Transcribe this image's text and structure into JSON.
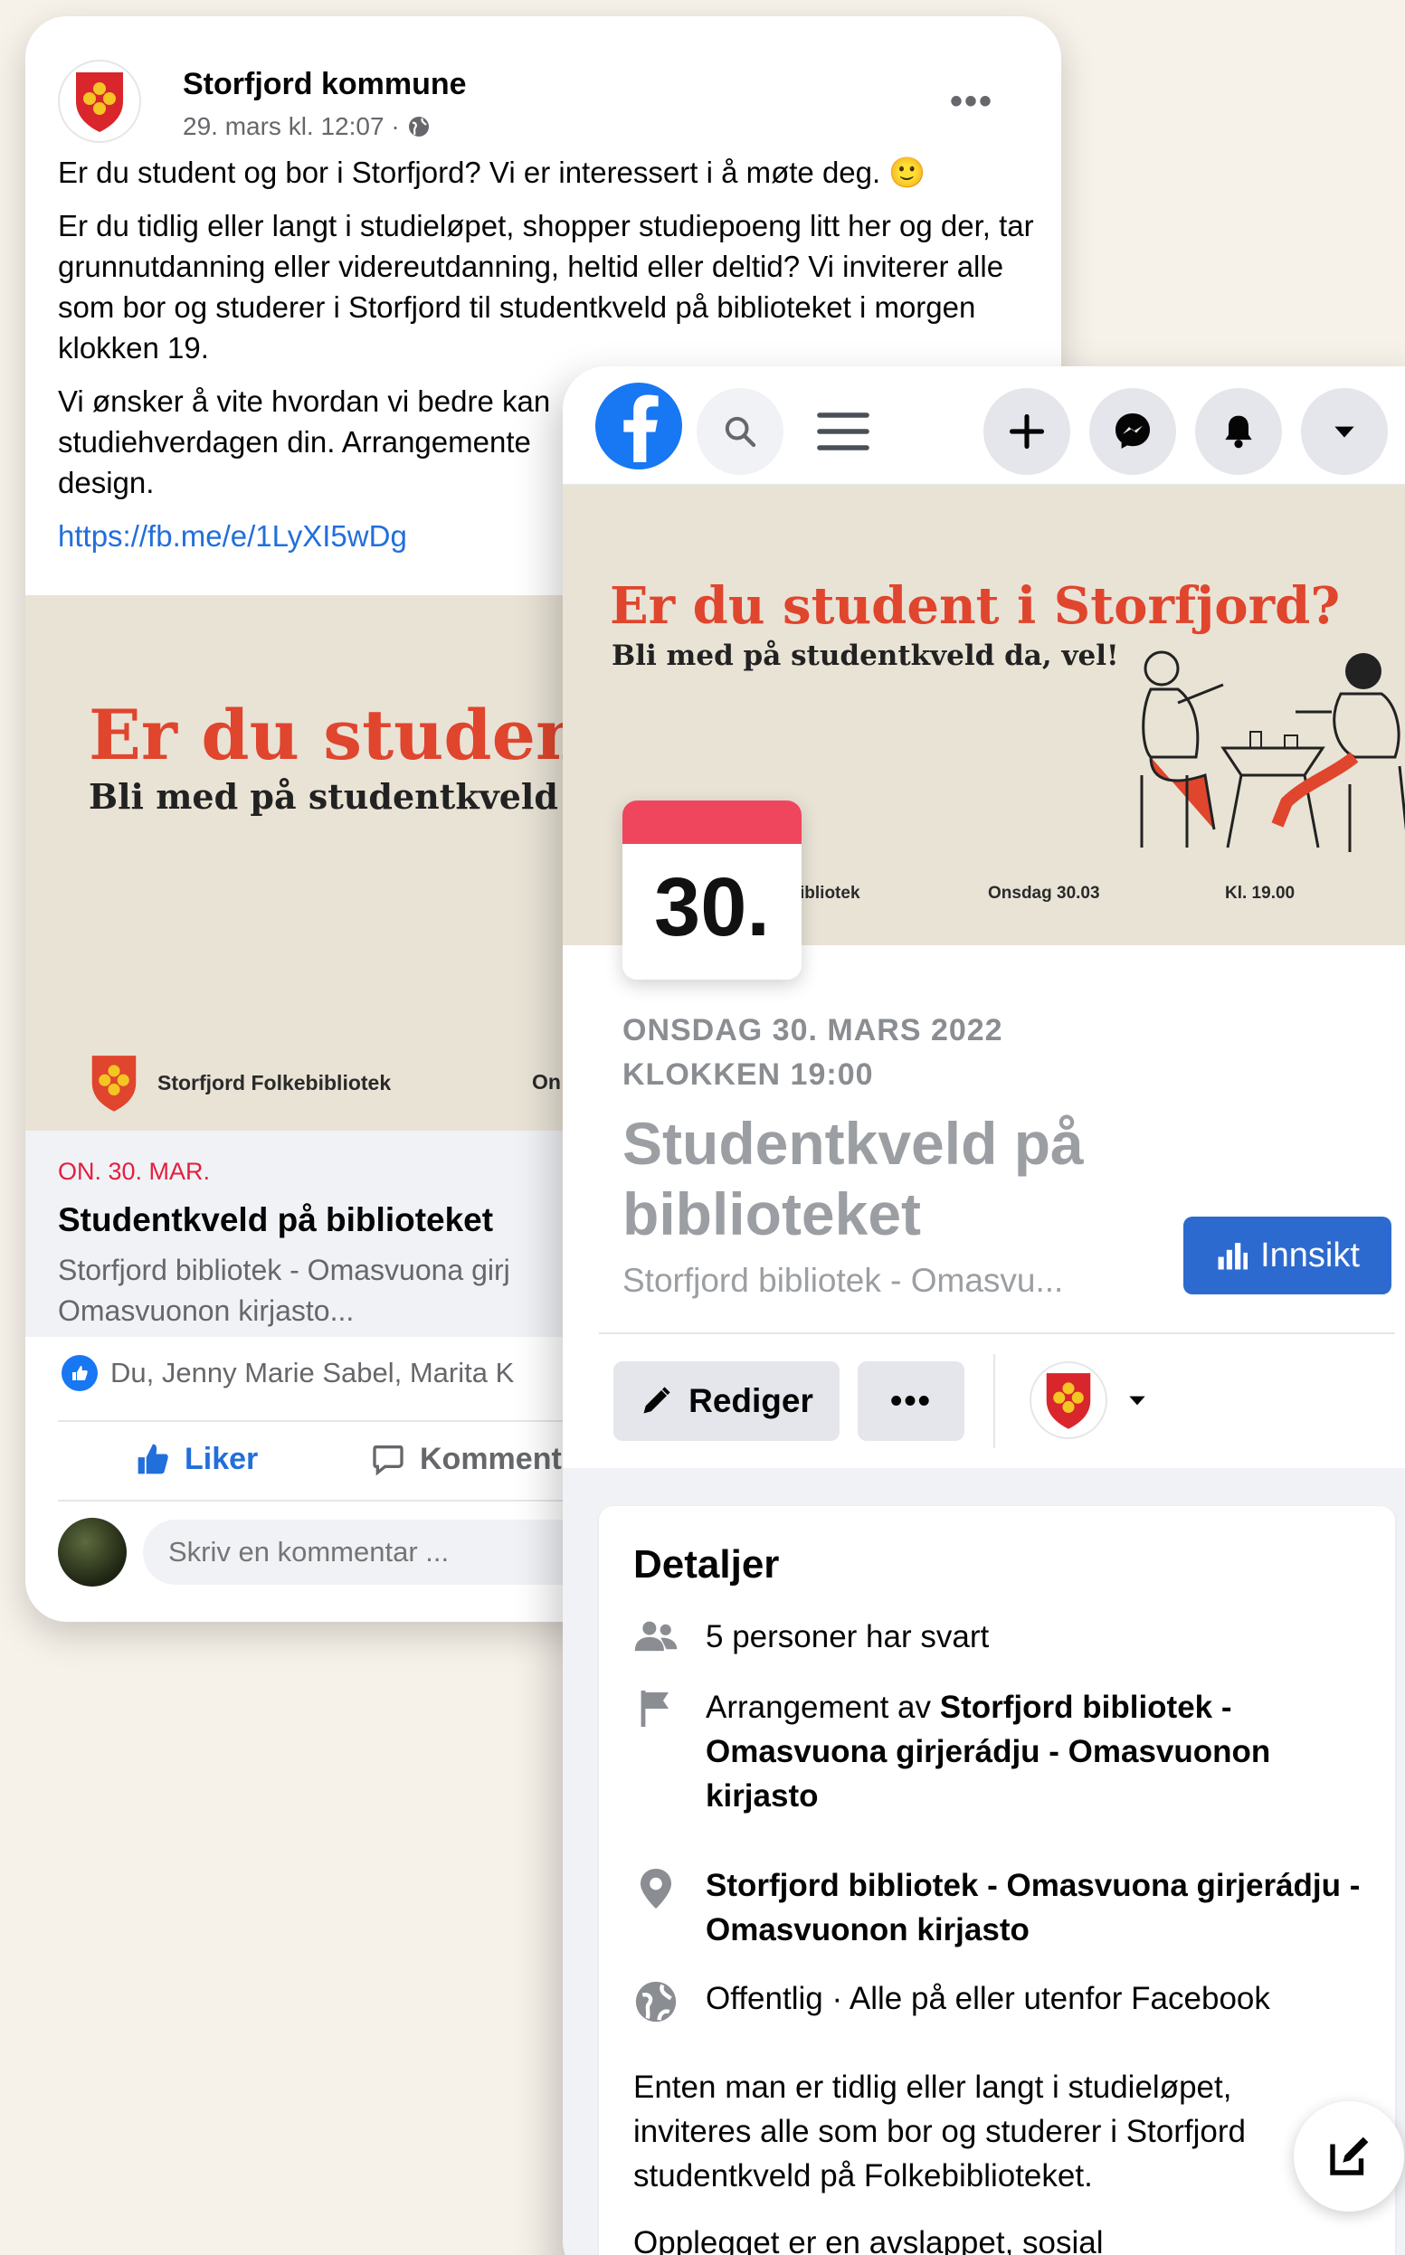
{
  "post": {
    "author": "Storfjord kommune",
    "timestamp": "29. mars kl. 12:07 ·",
    "privacy_icon": "globe-icon",
    "more_label": "•••",
    "paragraph1": "Er du student og bor i Storfjord? Vi er interessert i å møte deg. 🙂",
    "paragraph2": "Er du tidlig eller langt i studieløpet, shopper studiepoeng litt her og der, tar grunnutdanning eller videreutdanning, heltid eller deltid? Vi inviterer alle som bor og studerer i Storfjord til studentkveld på biblioteket i morgen klokken 19.",
    "paragraph3": "Vi ønsker å vite hvordan vi bedre kan studiehverdagen din. Arrangemente design.",
    "link": "https://fb.me/e/1LyXI5wDg",
    "banner": {
      "title": "Er du student i",
      "subtitle": "Bli med på studentkveld d",
      "logo_text": "Storfjord Folkebibliotek",
      "date_fragment": "On"
    },
    "event_preview": {
      "date": "ON. 30. MAR.",
      "title": "Studentkveld på biblioteket",
      "location": "Storfjord bibliotek - Omasvuona girj Omasvuonon kirjasto..."
    },
    "reactions_text": "Du, Jenny Marie Sabel, Marita K",
    "like_label": "Liker",
    "comment_label": "Komment",
    "comment_placeholder": "Skriv en kommentar ..."
  },
  "event": {
    "banner": {
      "title": "Er du student i Storfjord?",
      "subtitle": "Bli med på studentkveld da, vel!",
      "foot_library": "ibliotek",
      "foot_date": "Onsdag 30.03",
      "foot_time": "Kl. 19.00"
    },
    "calendar_day": "30.",
    "when_line1": "ONSDAG 30. MARS 2022",
    "when_line2": "KLOKKEN 19:00",
    "name": "Studentkveld på biblioteket",
    "host_short": "Storfjord bibliotek - Omasvu...",
    "insikt_label": "Innsikt",
    "edit_label": "Rediger",
    "more_label": "•••",
    "details": {
      "title": "Detaljer",
      "responses": "5 personer har svart",
      "organizer_prefix": "Arrangement av ",
      "organizer": "Storfjord bibliotek - Omasvuona girjerádju - Omasvuonon kirjasto",
      "location": "Storfjord bibliotek - Omasvuona girjerádju - Omasvuonon kirjasto",
      "privacy_prefix": "Offentlig",
      "privacy_rest": " · Alle på eller utenfor Facebook",
      "description": "Enten man er tidlig eller langt i studieløpet, inviteres alle som bor og studerer i Storfjord studentkveld på Folkebiblioteket.",
      "description2": "Opplegget er en avslappet, sosial"
    }
  },
  "colors": {
    "facebook_blue": "#1877f2",
    "insikt_blue": "#2d6ad0",
    "banner_red": "#e0452d",
    "calendar_red": "#f0465d",
    "background": "#f6f1e9"
  }
}
